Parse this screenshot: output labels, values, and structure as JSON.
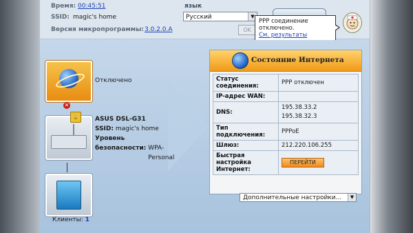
{
  "header": {
    "time_label": "Время:",
    "time_value": "00:45:51",
    "ssid_label": "SSID:",
    "ssid_value": "magic's home",
    "firmware_label": "Версия микропрограммы:",
    "firmware_value": "3.0.2.0.A",
    "language_label": "язык",
    "language_selected": "Русский",
    "ok_label": "OK"
  },
  "tooltip": {
    "line1": "PPP соединение",
    "line2": "отключено.",
    "link": "См. результаты диагностики."
  },
  "map": {
    "internet_status": "Отключено",
    "router_name": "ASUS DSL-G31",
    "router_ssid_label": "SSID:",
    "router_ssid_value": "magic's home",
    "security_label_1": "Уровень",
    "security_label_2": "безопасности:",
    "security_value": "WPA-Personal",
    "clients_label": "Клиенты:",
    "clients_count": "1"
  },
  "status_panel": {
    "title": "Состояние Интернета",
    "rows": [
      {
        "label": "Статус соединения:",
        "value": "PPP отключен"
      },
      {
        "label": "IP-адрес WAN:",
        "value": ""
      },
      {
        "label": "DNS:",
        "value": "195.38.33.2\n195.38.32.3"
      },
      {
        "label": "Тип подключения:",
        "value": "PPPoE"
      },
      {
        "label": "Шлюз:",
        "value": "212.220.106.255"
      },
      {
        "label": "Быстрая настройка Интернет:",
        "value": "ПЕРЕЙТИ"
      }
    ],
    "more_settings": "Дополнительные настройки..."
  },
  "icons": {
    "internet": "globe-icon",
    "disconnected": "x-icon",
    "router": "router-icon",
    "lock": "lock-icon",
    "clients": "computer-icon",
    "helper": "doctor-icon"
  }
}
